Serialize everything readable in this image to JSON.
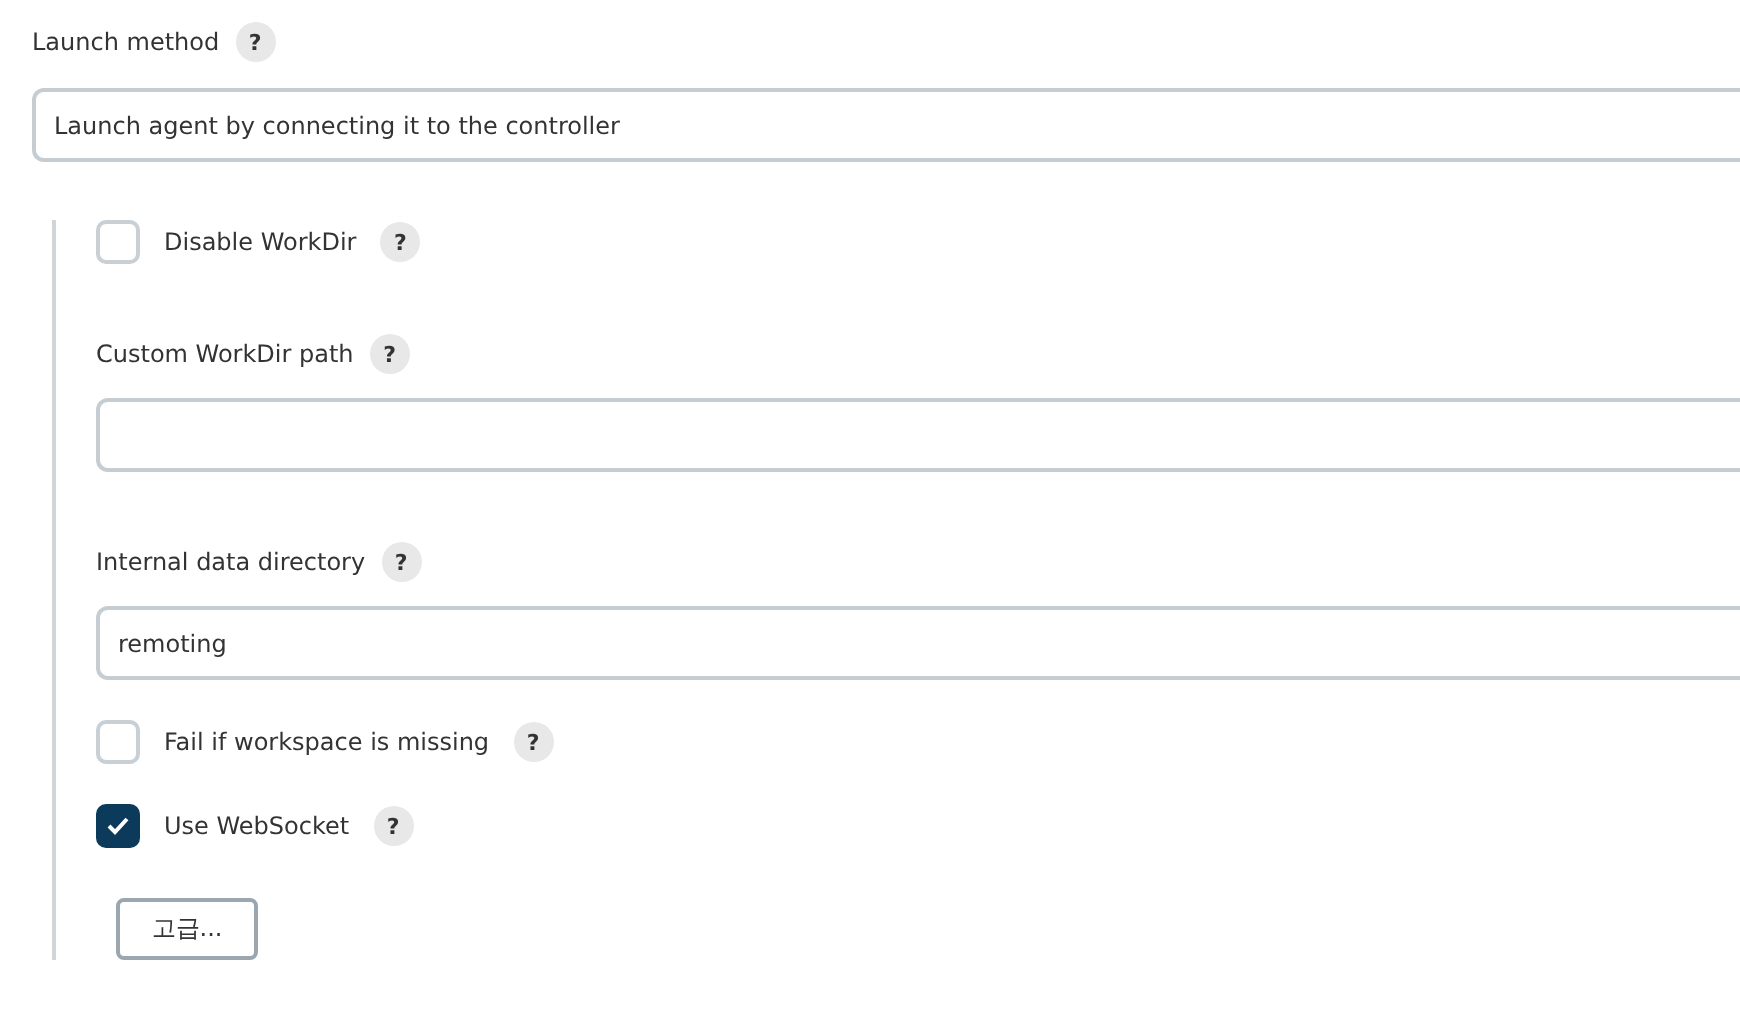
{
  "launch_method": {
    "label": "Launch method",
    "help": "?",
    "value": "Launch agent by connecting it to the controller"
  },
  "options": [
    {
      "kind": "checkbox",
      "label": "Disable WorkDir",
      "help": "?",
      "checked": false
    },
    {
      "kind": "field",
      "label": "Custom WorkDir path",
      "help": "?"
    },
    {
      "kind": "field",
      "label": "Internal data directory",
      "help": "?",
      "value": "remoting"
    },
    {
      "kind": "checkbox",
      "label": "Fail if workspace is missing",
      "help": "?",
      "checked": false
    },
    {
      "kind": "checkbox",
      "label": "Use WebSocket",
      "help": "?",
      "checked": true
    }
  ],
  "advanced_button": "고급..."
}
